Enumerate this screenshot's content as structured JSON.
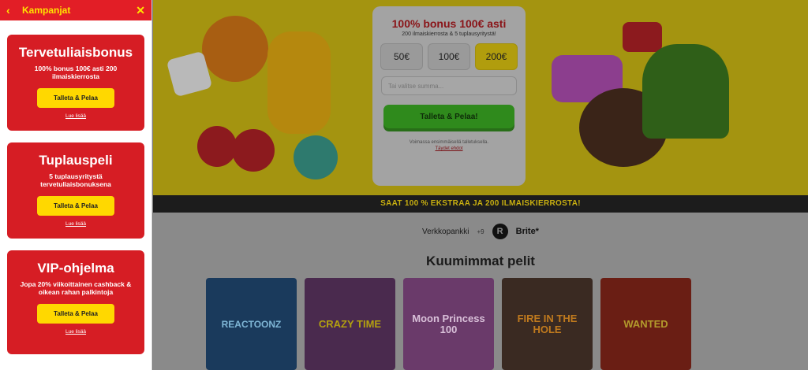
{
  "sidebar": {
    "title": "Kampanjat",
    "back_icon": "chevron-left-icon",
    "close_icon": "close-icon",
    "cards": [
      {
        "title": "Tervetuliaisbonus",
        "desc": "100% bonus 100€ asti 200 ilmaiskierrosta",
        "button": "Talleta & Pelaa",
        "link": "Lue lisää"
      },
      {
        "title": "Tuplauspeli",
        "desc": "5 tuplausyritystä tervetuliaisbonuksena",
        "button": "Talleta & Pelaa",
        "link": "Lue lisää"
      },
      {
        "title": "VIP-ohjelma",
        "desc": "Jopa 20% viikoittainen cashback & oikean rahan palkintoja",
        "button": "Talleta & Pelaa",
        "link": "Lue lisää"
      }
    ]
  },
  "widget": {
    "title": "100% bonus 100€ asti",
    "subtitle": "200 ilmaiskierrosta & 5 tuplausyritystä!",
    "amounts": [
      "50€",
      "100€",
      "200€"
    ],
    "selected_amount": "200€",
    "input_placeholder": "Tai valitse summa...",
    "deposit_button": "Talleta & Pelaa!",
    "terms_text": "Voimassa ensimmäisellä talletuksella.",
    "terms_link": "Täydet ehdot"
  },
  "banner": {
    "text": "SAAT 100 % EKSTRAA JA 200 ILMAISKIERROSTA!"
  },
  "payments": {
    "bank": "Verkkopankki",
    "plus": "+9",
    "provider": "Brite*"
  },
  "games": {
    "title": "Kuumimmat pelit",
    "items": [
      {
        "name": "REACTOONZ"
      },
      {
        "name": "CRAZY TIME"
      },
      {
        "name": "Moon Princess 100"
      },
      {
        "name": "FIRE IN THE HOLE"
      },
      {
        "name": "WANTED"
      }
    ]
  },
  "colors": {
    "sidebar_header": "#e21e26",
    "promo_card": "#d61d24",
    "promo_button": "#ffd800",
    "overlay_dim": "#7a7a7a"
  }
}
